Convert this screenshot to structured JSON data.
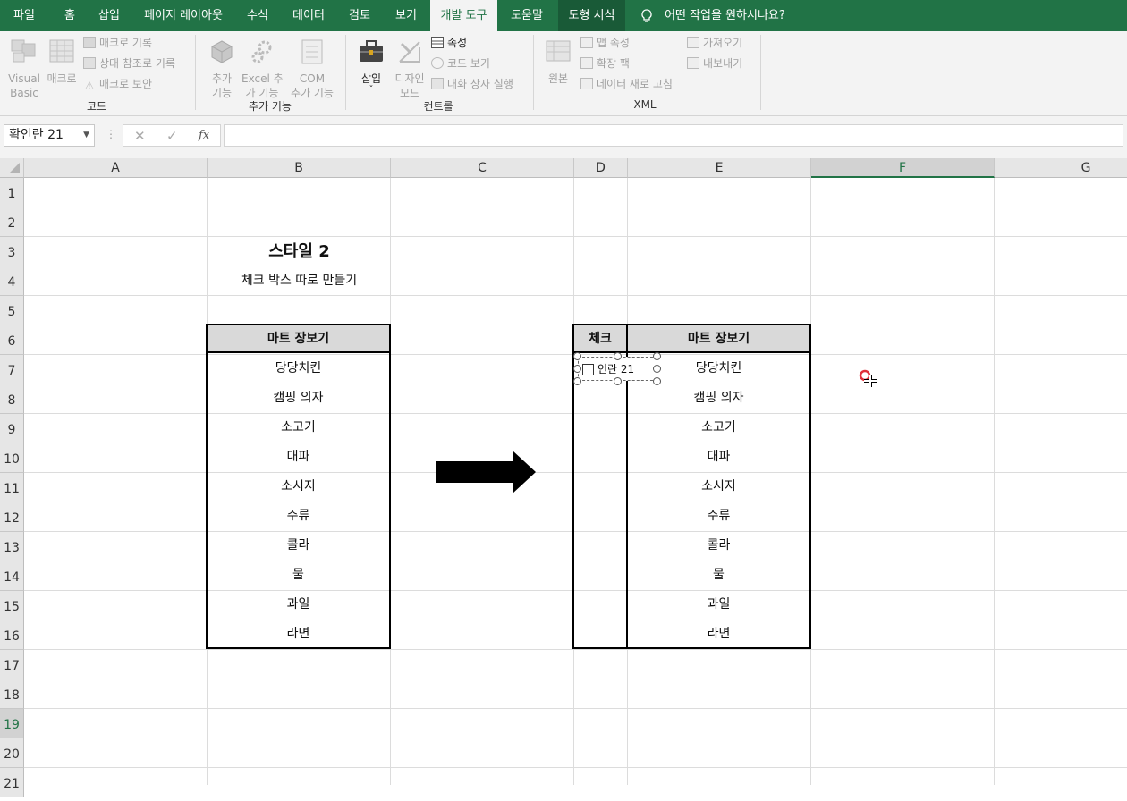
{
  "tabs": [
    {
      "label": "파일",
      "state": "normal"
    },
    {
      "label": "홈",
      "state": "normal"
    },
    {
      "label": "삽입",
      "state": "normal"
    },
    {
      "label": "페이지 레이아웃",
      "state": "normal"
    },
    {
      "label": "수식",
      "state": "normal"
    },
    {
      "label": "데이터",
      "state": "normal"
    },
    {
      "label": "검토",
      "state": "normal"
    },
    {
      "label": "보기",
      "state": "normal"
    },
    {
      "label": "개발 도구",
      "state": "active"
    },
    {
      "label": "도움말",
      "state": "normal"
    },
    {
      "label": "도형 서식",
      "state": "context"
    }
  ],
  "tell_me": "어떤 작업을 원하시나요?",
  "ribbon": {
    "code": {
      "label": "코드",
      "visual_basic": [
        "Visual",
        "Basic"
      ],
      "macros": "매크로",
      "record_macro": "매크로 기록",
      "relative_ref": "상대 참조로 기록",
      "macro_security": "매크로 보안"
    },
    "addins": {
      "label": "추가 기능",
      "addins": [
        "추가",
        "기능"
      ],
      "excel_addins": [
        "Excel 추",
        "가 기능"
      ],
      "com_addins": [
        "COM",
        "추가 기능"
      ]
    },
    "controls": {
      "label": "컨트롤",
      "insert": "삽입",
      "insert_arrow": "ˇ",
      "design_mode": [
        "디자인",
        "모드"
      ],
      "properties": "속성",
      "view_code": "코드 보기",
      "run_dialog": "대화 상자 실행"
    },
    "xml": {
      "label": "XML",
      "source": "원본",
      "map_properties": "맵 속성",
      "expansion_packs": "확장 팩",
      "refresh_data": "데이터 새로 고침",
      "import": "가져오기",
      "export": "내보내기"
    }
  },
  "formula_bar": {
    "name_box": "확인란 21",
    "fx": "fx",
    "cancel": "✕",
    "enter": "✓",
    "value": ""
  },
  "columns": [
    "A",
    "B",
    "C",
    "D",
    "E",
    "F",
    "G"
  ],
  "selected_column": "F",
  "rows": [
    "1",
    "2",
    "3",
    "4",
    "5",
    "6",
    "7",
    "8",
    "9",
    "10",
    "11",
    "12",
    "13",
    "14",
    "15",
    "16",
    "17",
    "18",
    "19",
    "20",
    "21"
  ],
  "selected_row": "19",
  "sheet": {
    "title": "스타일 2",
    "subtitle": "체크 박스 따로 만들기",
    "left_table_header": "마트 장보기",
    "right_check_header": "체크",
    "right_table_header": "마트 장보기",
    "items": [
      "당당치킨",
      "캠핑 의자",
      "소고기",
      "대파",
      "소시지",
      "주류",
      "콜라",
      "물",
      "과일",
      "라면"
    ],
    "checkbox_label": "인란 21"
  },
  "colors": {
    "ribbon_green": "#217346",
    "context_tab": "#195a37",
    "table_header_fill": "#d9d9d9",
    "pointer_ring": "#e0303a"
  }
}
